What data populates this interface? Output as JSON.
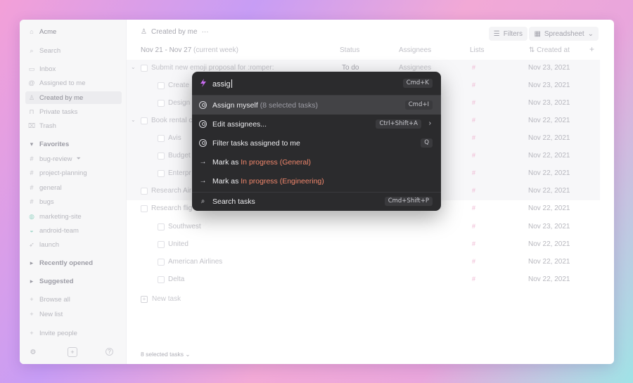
{
  "workspace": "Acme",
  "sidebar": {
    "search": "Search",
    "nav": [
      {
        "label": "Inbox",
        "icon": "inbox-icon"
      },
      {
        "label": "Assigned to me",
        "icon": "at-icon"
      },
      {
        "label": "Created by me",
        "icon": "person-icon"
      },
      {
        "label": "Private tasks",
        "icon": "lock-icon"
      },
      {
        "label": "Trash",
        "icon": "trash-icon"
      }
    ],
    "favorites_label": "Favorites",
    "favorites": [
      {
        "label": "bug-review",
        "icon": "hash-icon"
      },
      {
        "label": "project-planning",
        "icon": "hash-icon"
      },
      {
        "label": "general",
        "icon": "hash-icon"
      },
      {
        "label": "bugs",
        "icon": "hash-icon"
      },
      {
        "label": "marketing-site",
        "icon": "globe-icon"
      },
      {
        "label": "android-team",
        "icon": "android-icon"
      },
      {
        "label": "launch",
        "icon": "rocket-icon"
      }
    ],
    "recently_opened": "Recently opened",
    "suggested": "Suggested",
    "browse_all": "Browse all",
    "new_list": "New list",
    "invite": "Invite people"
  },
  "header": {
    "title": "Created by me",
    "more": "···",
    "filters": "Filters",
    "view": "Spreadsheet"
  },
  "columns": {
    "range": "Nov 21 - Nov 27",
    "range_note": "(current week)",
    "status": "Status",
    "assignees": "Assignees",
    "lists": "Lists",
    "created": "Created at"
  },
  "rows": [
    {
      "title": "Submit new emoji proposal for :romper:",
      "status": "To do",
      "assignee": "Assignees",
      "date": "Nov 23, 2021"
    },
    {
      "title": "Create",
      "date": "Nov 23, 2021"
    },
    {
      "title": "Design",
      "date": "Nov 23, 2021"
    },
    {
      "title": "Book rental c",
      "date": "Nov 22, 2021"
    },
    {
      "title": "Avis",
      "date": "Nov 22, 2021"
    },
    {
      "title": "Budget",
      "date": "Nov 22, 2021"
    },
    {
      "title": "Enterpr",
      "date": "Nov 22, 2021"
    },
    {
      "title": "Research Air",
      "date": "Nov 22, 2021"
    },
    {
      "title": "Research flig",
      "date": "Nov 22, 2021"
    },
    {
      "title": "Southwest",
      "date": "Nov 23, 2021"
    },
    {
      "title": "United",
      "date": "Nov 22, 2021"
    },
    {
      "title": "American Airlines",
      "date": "Nov 22, 2021"
    },
    {
      "title": "Delta",
      "date": "Nov 22, 2021"
    }
  ],
  "new_task": "New task",
  "selected": "8 selected tasks",
  "palette": {
    "query": "assig",
    "shortcut": "Cmd+K",
    "items": [
      {
        "label": "Assign myself",
        "note": "(8 selected tasks)",
        "shortcut": "Cmd+I",
        "icon": "assignee-icon"
      },
      {
        "label": "Edit assignees...",
        "shortcut": "Ctrl+Shift+A",
        "icon": "assignee-icon"
      },
      {
        "label": "Filter tasks assigned to me",
        "shortcut": "Q",
        "icon": "assignee-icon"
      },
      {
        "label": "Mark as",
        "tag": "In progress (General)",
        "icon": "arrow-right-icon"
      },
      {
        "label": "Mark as",
        "tag": "In progress (Engineering)",
        "icon": "arrow-right-icon"
      },
      {
        "label": "Search tasks",
        "shortcut": "Cmd+Shift+P",
        "icon": "search-icon"
      }
    ]
  },
  "colors": {
    "accent": "#f0866b",
    "palette_bg": "#2b2b2d",
    "highlight": "#434346"
  }
}
